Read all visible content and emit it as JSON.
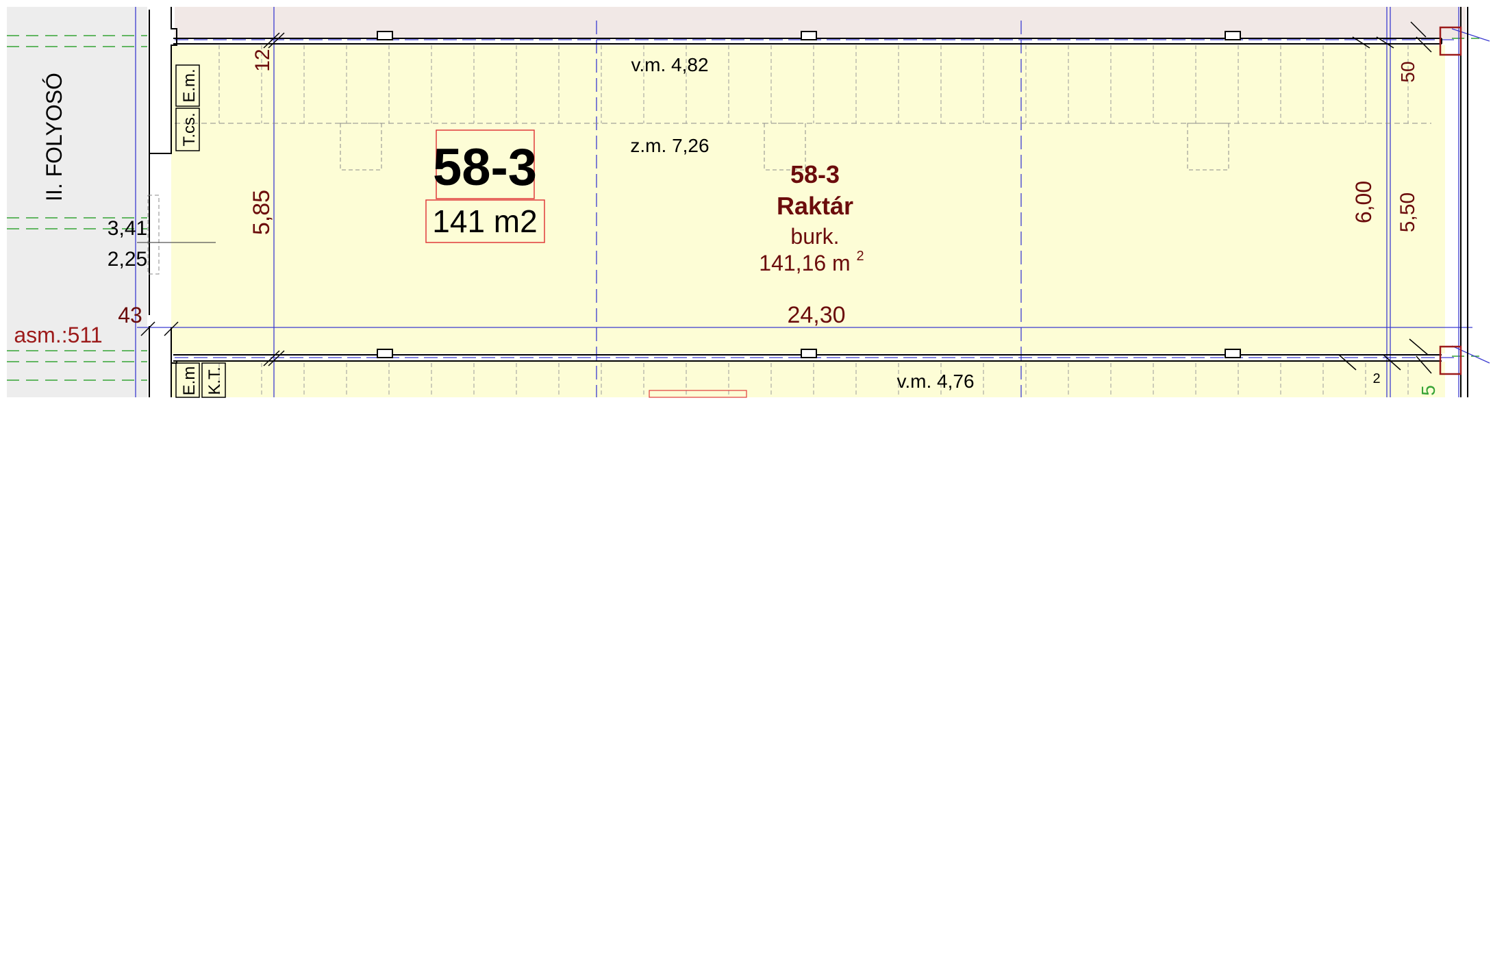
{
  "corridor": {
    "label": "II. FOLYOSÓ"
  },
  "room": {
    "id_badge": "58-3",
    "area_badge": "141 m2",
    "number": "58-3",
    "name": "Raktár",
    "floor": "burk.",
    "area_value": "141,16 m",
    "area_unit_sup": "2"
  },
  "dimensions": {
    "vm_top": "v.m. 4,82",
    "zm": "z.m. 7,26",
    "vm_bottom": "v.m. 4,76",
    "left_height": "5,85",
    "top_left": "12",
    "length": "24,30",
    "right_height_outer": "6,00",
    "right_height_inner": "5,50",
    "right_top": "50",
    "small_2": "2",
    "small_5": "5",
    "wall_43": "43",
    "dim_341": "3,41",
    "dim_225": "2,25",
    "asm": "asm.:511"
  },
  "fixtures": {
    "em_top": "E.m.",
    "tcs": "T.cs.",
    "em_bottom": "E.m",
    "kt": "K.T."
  },
  "colors": {
    "room_fill": "#fdfdd6",
    "corridor_fill": "#ededed",
    "top_band_fill": "#f1e8e6",
    "wall": "#000000",
    "dim_blue": "#3b3bd0",
    "hatch_green": "#35a335",
    "room_text": "#6b0c0c",
    "badge_border": "#e03a3a",
    "column_red": "#9c1a1a"
  }
}
